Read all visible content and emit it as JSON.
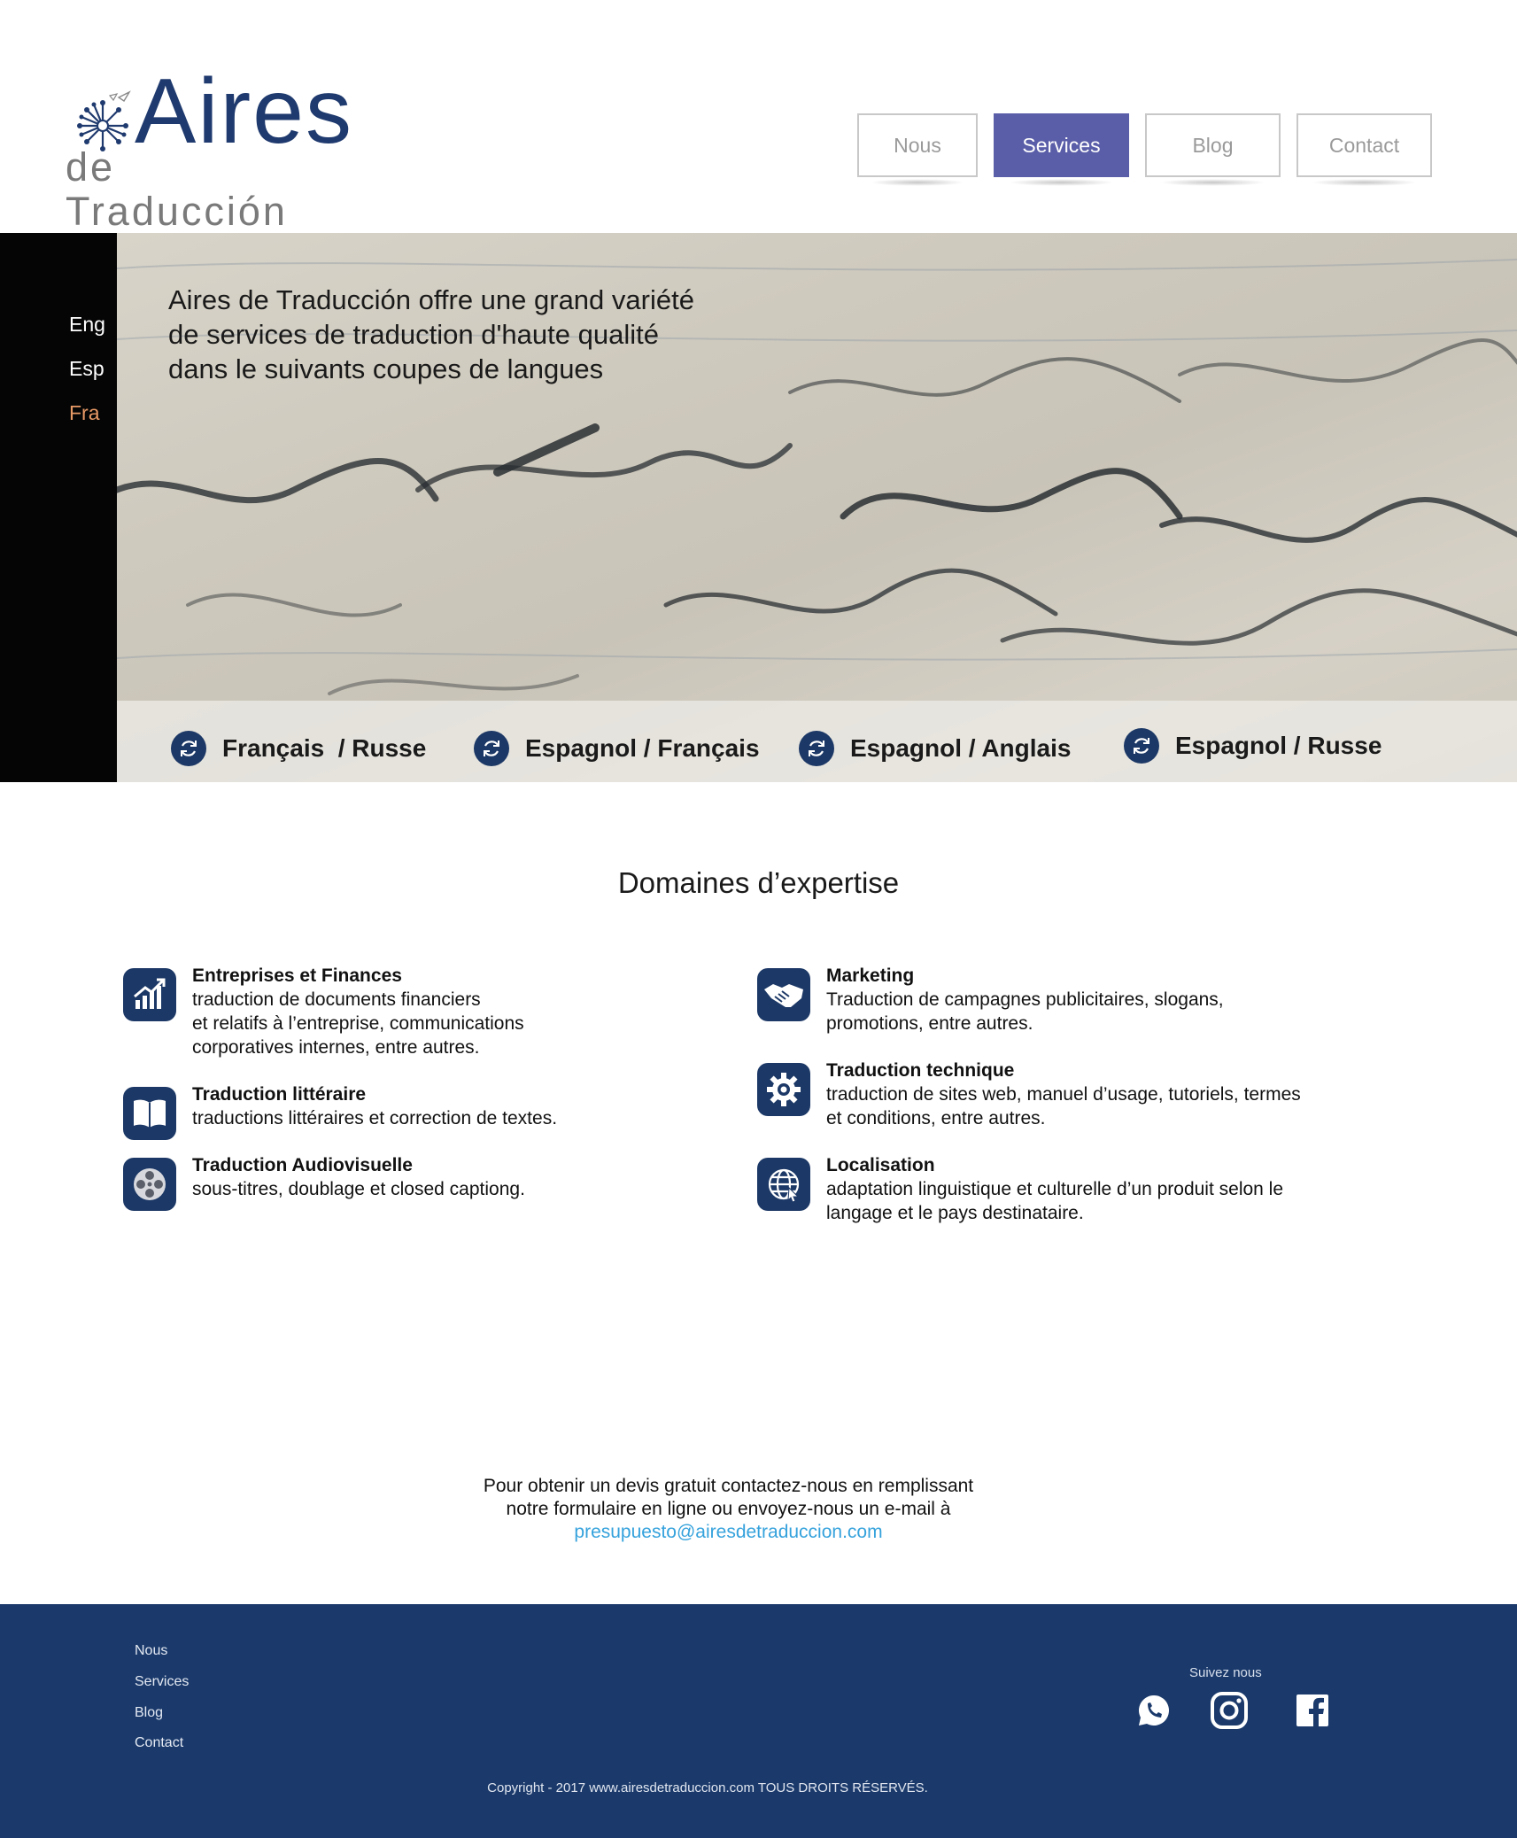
{
  "brand": {
    "name_main": "Aires",
    "name_sub": "de Traducción"
  },
  "nav": {
    "items": [
      {
        "label": "Nous"
      },
      {
        "label": "Services"
      },
      {
        "label": "Blog"
      },
      {
        "label": "Contact"
      }
    ],
    "active": "Services",
    "accent_color": "#5a5ea8"
  },
  "languages": {
    "items": [
      {
        "label": "Eng"
      },
      {
        "label": "Esp"
      },
      {
        "label": "Fra"
      }
    ],
    "active": "Fra",
    "active_color": "#e89a66"
  },
  "hero": {
    "lines": [
      "Aires de Traducción offre une grand variété",
      "de services de traduction d'haute qualité",
      "dans le suivants coupes de langues"
    ],
    "pairs": [
      {
        "label": "Français  / Russe",
        "icon": "refresh-icon"
      },
      {
        "label": "Espagnol / Français",
        "icon": "refresh-icon"
      },
      {
        "label": "Espagnol / Anglais",
        "icon": "refresh-icon"
      },
      {
        "label": "Espagnol / Russe",
        "icon": "refresh-icon"
      }
    ]
  },
  "expertise": {
    "title": "Domaines d’expertise",
    "items": [
      {
        "title": "Entreprises et Finances",
        "desc": "traduction de documents financiers\net relatifs à l’entreprise, communications\ncorporatives internes, entre autres.",
        "icon": "growth-chart-icon"
      },
      {
        "title": "Traduction littéraire",
        "desc": "traductions littéraires et correction de textes.",
        "icon": "book-icon"
      },
      {
        "title": "Traduction Audiovisuelle",
        "desc": "sous-titres, doublage et closed captiong.",
        "icon": "film-reel-icon"
      },
      {
        "title": "Marketing",
        "desc": "Traduction de campagnes publicitaires, slogans,\npromotions, entre autres.",
        "icon": "handshake-icon"
      },
      {
        "title": "Traduction technique",
        "desc": "traduction de sites web, manuel d’usage, tutoriels, termes\net conditions, entre autres.",
        "icon": "gear-icon"
      },
      {
        "title": "Localisation",
        "desc": "adaptation linguistique et culturelle d’un produit selon le\nlangage et le pays destinataire.",
        "icon": "globe-icon"
      }
    ]
  },
  "contact": {
    "line1": "Pour obtenir un devis gratuit contactez-nous en remplissant",
    "line2": "notre formulaire en ligne ou envoyez-nous un e-mail à",
    "email": "presupuesto@airesdetraduccion.com",
    "email_color": "#35a2dc"
  },
  "footer": {
    "links": [
      {
        "label": "Nous"
      },
      {
        "label": "Services"
      },
      {
        "label": "Blog"
      },
      {
        "label": "Contact"
      }
    ],
    "follow_label": "Suivez nous",
    "social": [
      {
        "name": "whatsapp-icon"
      },
      {
        "name": "instagram-icon"
      },
      {
        "name": "facebook-icon"
      }
    ],
    "copyright": "Copyright - 2017 www.airesdetraduccion.com  TOUS DROITS RÉSERVÉS.",
    "background": "#1b3a6b"
  }
}
